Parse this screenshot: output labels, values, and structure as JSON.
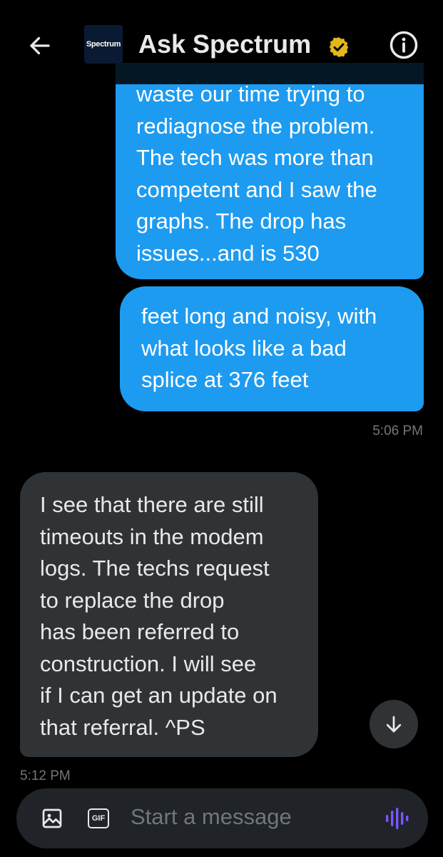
{
  "header": {
    "title": "Ask Spectrum",
    "avatar_text": "Spectrum",
    "back_icon": "arrow-left-icon",
    "verified_icon": "verified-badge-icon",
    "info_icon": "info-icon"
  },
  "messages": [
    {
      "direction": "outgoing",
      "text": "waste our time trying to\nrediagnose the problem.\nThe tech was more than\ncompetent and I saw the\ngraphs. The drop has\nissues...and is 530"
    },
    {
      "direction": "outgoing",
      "text": "feet long and noisy, with\nwhat looks like a bad\nsplice at 376 feet"
    },
    {
      "direction": "incoming",
      "text": "I see that there are still\ntimeouts in the modem\nlogs.  The techs request\nto replace the drop\nhas been referred to\nconstruction. I will see\nif I can get an update on\nthat referral.  ^PS"
    }
  ],
  "timestamps": {
    "outgoing": "5:06 PM",
    "incoming": "5:12 PM"
  },
  "composer": {
    "placeholder": "Start a message",
    "gif_label": "GIF",
    "image_icon": "image-icon",
    "voice_icon": "voice-message-icon"
  },
  "colors": {
    "background": "#000000",
    "outgoing_bubble": "#1d9bf0",
    "incoming_bubble": "#2f3336",
    "accent_voice": "#7856ff",
    "verified_gold": "#e2b719"
  }
}
